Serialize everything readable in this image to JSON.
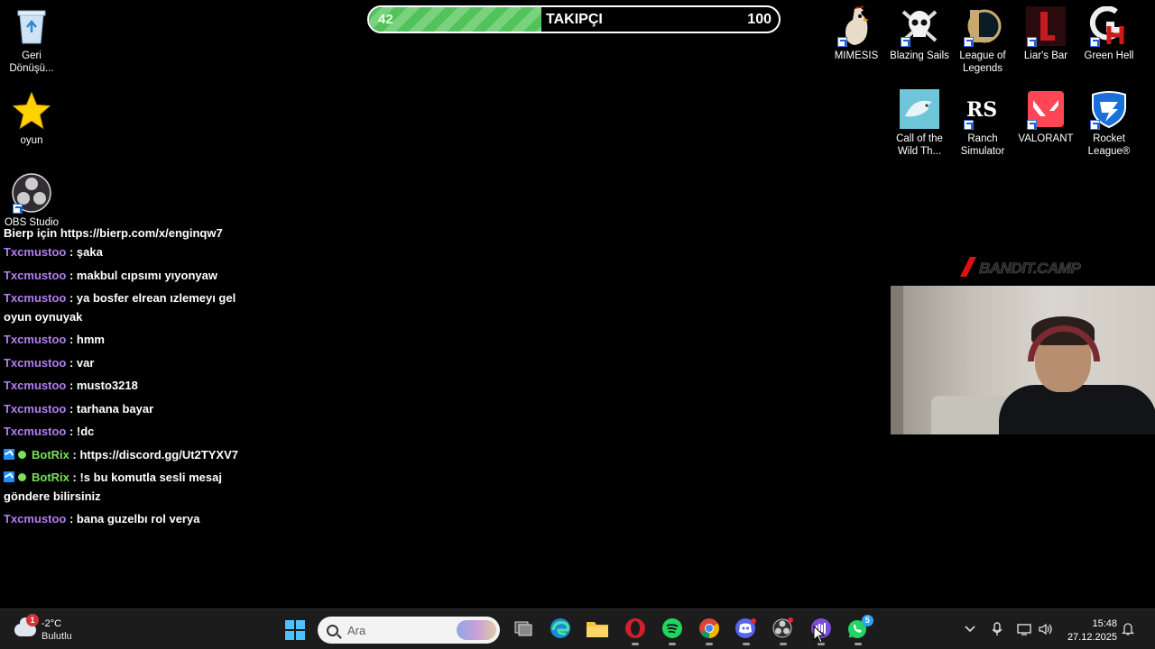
{
  "desktop_left": [
    {
      "label": "Geri Dönüşü...",
      "icon": "recycle-bin-icon"
    },
    {
      "label": "oyun",
      "icon": "star-folder-icon"
    },
    {
      "label": "OBS Studio",
      "icon": "obs-icon"
    }
  ],
  "desktop_right_row1": [
    {
      "label": "MIMESIS",
      "icon": "rooster-icon"
    },
    {
      "label": "Blazing Sails",
      "icon": "skull-icon"
    },
    {
      "label": "League of Legends",
      "icon": "league-of-legends-icon"
    },
    {
      "label": "Liar's Bar",
      "icon": "liars-bar-icon"
    },
    {
      "label": "Green Hell",
      "icon": "green-hell-icon"
    }
  ],
  "desktop_right_row2": [
    {
      "label": "Call of the Wild Th...",
      "icon": "fish-icon"
    },
    {
      "label": "Ranch Simulator",
      "icon": "ranch-simulator-icon"
    },
    {
      "label": "VALORANT",
      "icon": "valorant-icon"
    },
    {
      "label": "Rocket League®",
      "icon": "rocket-league-icon"
    }
  ],
  "follower_goal": {
    "current": "42",
    "title": "TAKIPÇI",
    "goal": "100",
    "progress": 0.42
  },
  "chat": {
    "first_line": "Bierp için https://bierp.com/x/enginqw7",
    "messages": [
      {
        "user": "Txcmustoo",
        "text": ": şaka",
        "bot": false
      },
      {
        "user": "Txcmustoo",
        "text": ": makbul cıpsımı yıyonyaw",
        "bot": false
      },
      {
        "user": "Txcmustoo",
        "text": ": ya bosfer elrean ızlemeyı gel oyun oynuyak",
        "bot": false
      },
      {
        "user": "Txcmustoo",
        "text": ": hmm",
        "bot": false
      },
      {
        "user": "Txcmustoo",
        "text": ": var",
        "bot": false
      },
      {
        "user": "Txcmustoo",
        "text": ": musto3218",
        "bot": false
      },
      {
        "user": "Txcmustoo",
        "text": ": tarhana bayar",
        "bot": false
      },
      {
        "user": "Txcmustoo",
        "text": ": !dc",
        "bot": false
      },
      {
        "user": "BotRix",
        "text": ": https://discord.gg/Ut2TYXV7",
        "bot": true
      },
      {
        "user": "BotRix",
        "text": ": !s bu komutla sesli mesaj göndere bilirsiniz",
        "bot": true
      },
      {
        "user": "Txcmustoo",
        "text": ": bana guzelbı rol verya",
        "bot": false
      }
    ]
  },
  "brand": "BANDIT.CAMP",
  "taskbar": {
    "weather_temp": "-2°C",
    "weather_desc": "Bulutlu",
    "weather_badge": "1",
    "search_placeholder": "Ara",
    "apps": [
      {
        "name": "task-view-icon",
        "label": ""
      },
      {
        "name": "edge-icon",
        "label": ""
      },
      {
        "name": "file-explorer-icon",
        "label": ""
      },
      {
        "name": "opera-icon",
        "label": ""
      },
      {
        "name": "spotify-icon",
        "label": ""
      },
      {
        "name": "chrome-icon",
        "label": ""
      },
      {
        "name": "discord-icon",
        "label": ""
      },
      {
        "name": "obs-icon",
        "label": ""
      },
      {
        "name": "podcast-app-icon",
        "label": ""
      },
      {
        "name": "whatsapp-icon",
        "label": "5"
      }
    ],
    "time": "15:48",
    "date": "27.12.2025"
  },
  "colors": {
    "chat_user": "#b27ef2",
    "chat_bot": "#7be05c",
    "progress_fill": "#52c25a",
    "taskbar_bg": "#1c1c1c"
  }
}
